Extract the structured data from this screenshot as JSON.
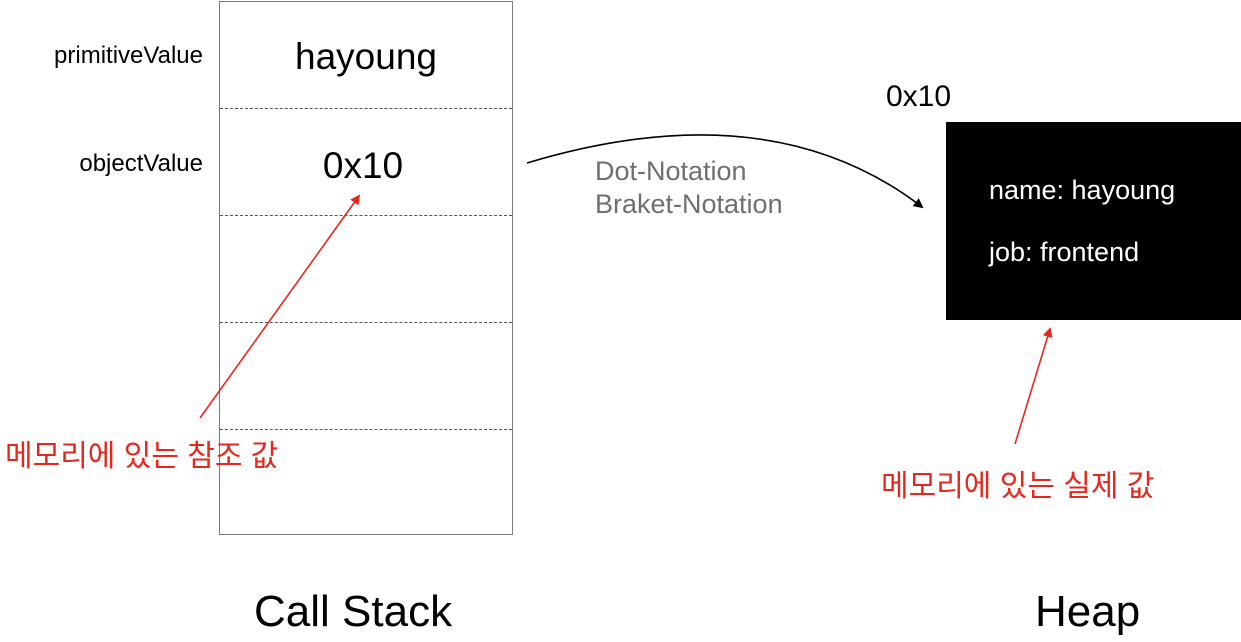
{
  "call_stack": {
    "title": "Call Stack",
    "rows": [
      {
        "variable": "primitiveValue",
        "value": "hayoung"
      },
      {
        "variable": "objectValue",
        "value": "0x10"
      },
      {
        "variable": "",
        "value": ""
      },
      {
        "variable": "",
        "value": ""
      },
      {
        "variable": "",
        "value": ""
      }
    ]
  },
  "heap": {
    "title": "Heap",
    "address": "0x10",
    "properties": [
      "name: hayoung",
      "job: frontend"
    ]
  },
  "arrow_labels": {
    "line1": "Dot-Notation",
    "line2": "Braket-Notation"
  },
  "annotations": {
    "reference_value": "메모리에 있는 참조 값",
    "actual_value": "메모리에 있는 실제 값"
  },
  "colors": {
    "annotation": "#e8261b",
    "heap_box": "#000000",
    "notation_text": "#6f6f6f"
  }
}
